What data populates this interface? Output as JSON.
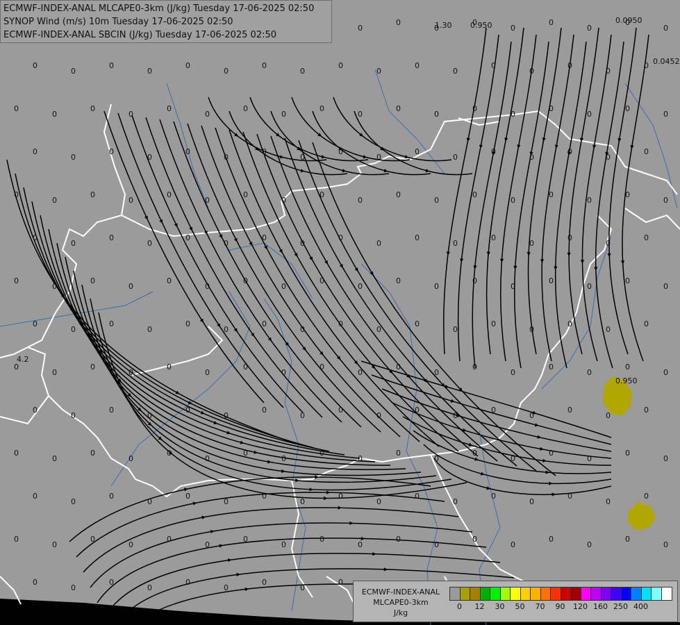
{
  "header": {
    "line1": "ECMWF-INDEX-ANAL MLCAPE0-3km (J/kg) Tuesday 17-06-2025 02:50",
    "line2": "SYNOP Wind (m/s) 10m Tuesday 17-06-2025 02:50",
    "line3": "ECMWF-INDEX-ANAL SBCIN (J/kg) Tuesday 17-06-2025 02:50"
  },
  "legend": {
    "line1": "ECMWF-INDEX-ANAL",
    "line2": "MLCAPE0-3km",
    "line3": "J/kg",
    "colors": [
      "#9a9a9a",
      "#a8a000",
      "#a88000",
      "#00b000",
      "#00f000",
      "#a0ff00",
      "#ffff00",
      "#ffd000",
      "#ffb000",
      "#ff7000",
      "#ff3000",
      "#d00000",
      "#a00000",
      "#ff00ff",
      "#c000ff",
      "#8000ff",
      "#4000ff",
      "#0000ff",
      "#0080ff",
      "#00e0ff",
      "#80ffff",
      "#ffffff"
    ],
    "ticks": [
      "0",
      "12",
      "30",
      "50",
      "70",
      "90",
      "120",
      "160",
      "250",
      "400"
    ]
  },
  "map": {
    "colors": {
      "background": "#9b9b9b",
      "sea": "#000000",
      "border": "#ffffff",
      "river": "#3a6fb0",
      "streamline": "#000000",
      "cape_blob": "#b0a800"
    },
    "annotations": [
      "1.30",
      "0.950",
      "0.0950",
      "0.0452",
      "4.2",
      "0.950"
    ],
    "value_label": "0"
  }
}
